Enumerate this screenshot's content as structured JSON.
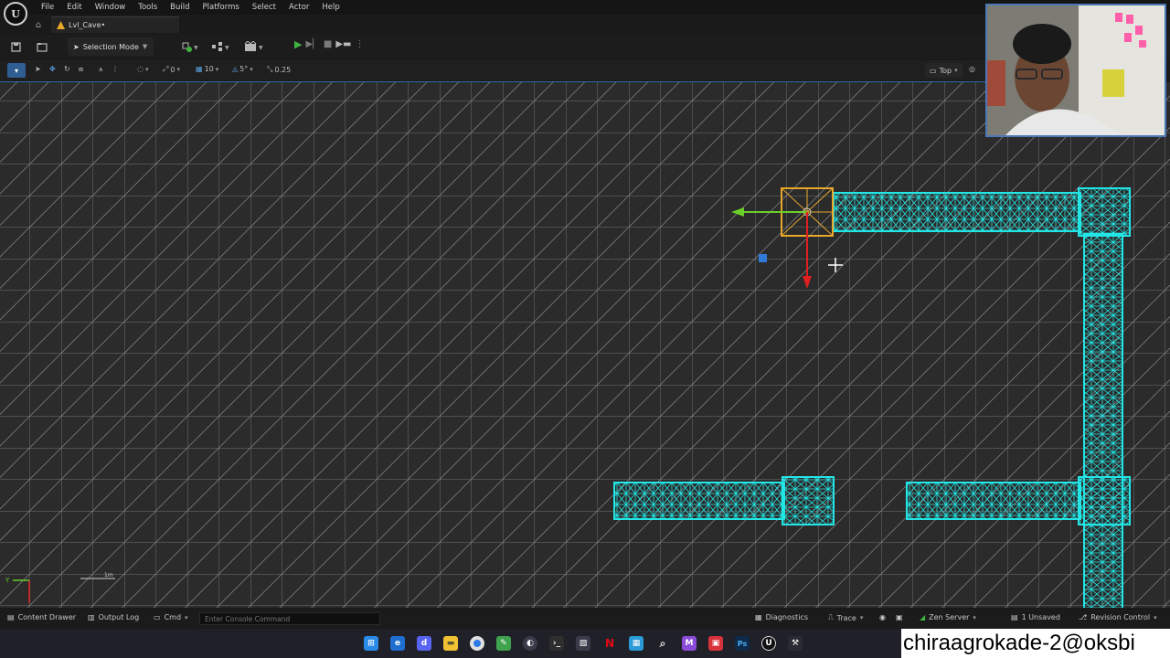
{
  "menu": {
    "items": [
      "File",
      "Edit",
      "Window",
      "Tools",
      "Build",
      "Platforms",
      "Select",
      "Actor",
      "Help"
    ]
  },
  "tab": {
    "level_name": "Lvl_Cave•"
  },
  "toolbar": {
    "mode_label": "Selection Mode",
    "icons": [
      "save-icon",
      "content-browser-icon",
      "add-actor-icon",
      "blueprint-icon",
      "cinematics-icon",
      "play-icon",
      "advance-frame-icon",
      "stop-icon",
      "launch-icon",
      "more-icon"
    ]
  },
  "viewport_toolbar": {
    "rotation_snap_value": "0",
    "grid_snap_value": "10",
    "angle_snap_value": "5°",
    "scale_snap_value": "0.25",
    "view_label": "Top"
  },
  "viewport": {
    "grid_color": "#8a8a8a",
    "wire_color": "#22e6e6",
    "selected_color": "#e8a72a",
    "gizmo_x_color": "#6ad02a",
    "gizmo_y_color": "#e02020",
    "scale_label": "1m",
    "axis_label": "Y"
  },
  "statusbar": {
    "content_drawer": "Content Drawer",
    "output_log": "Output Log",
    "cmd": "Cmd",
    "console_placeholder": "Enter Console Command",
    "diagnostics": "Diagnostics",
    "trace": "Trace",
    "zen_server": "Zen Server",
    "unsaved": "1 Unsaved",
    "revision_control": "Revision Control"
  },
  "taskbar": {
    "icons": [
      "windows-start-icon",
      "edge-icon",
      "discord-icon",
      "files-icon",
      "chrome-icon",
      "notepad-icon",
      "obs-icon",
      "terminal-icon",
      "screenshot-icon",
      "netflix-icon",
      "store-icon",
      "search-icon",
      "visual-studio-icon",
      "media-icon",
      "photoshop-icon",
      "unreal-icon",
      "tool-icon"
    ]
  },
  "overlay_text": "chiraagrokade-2@oksbi"
}
